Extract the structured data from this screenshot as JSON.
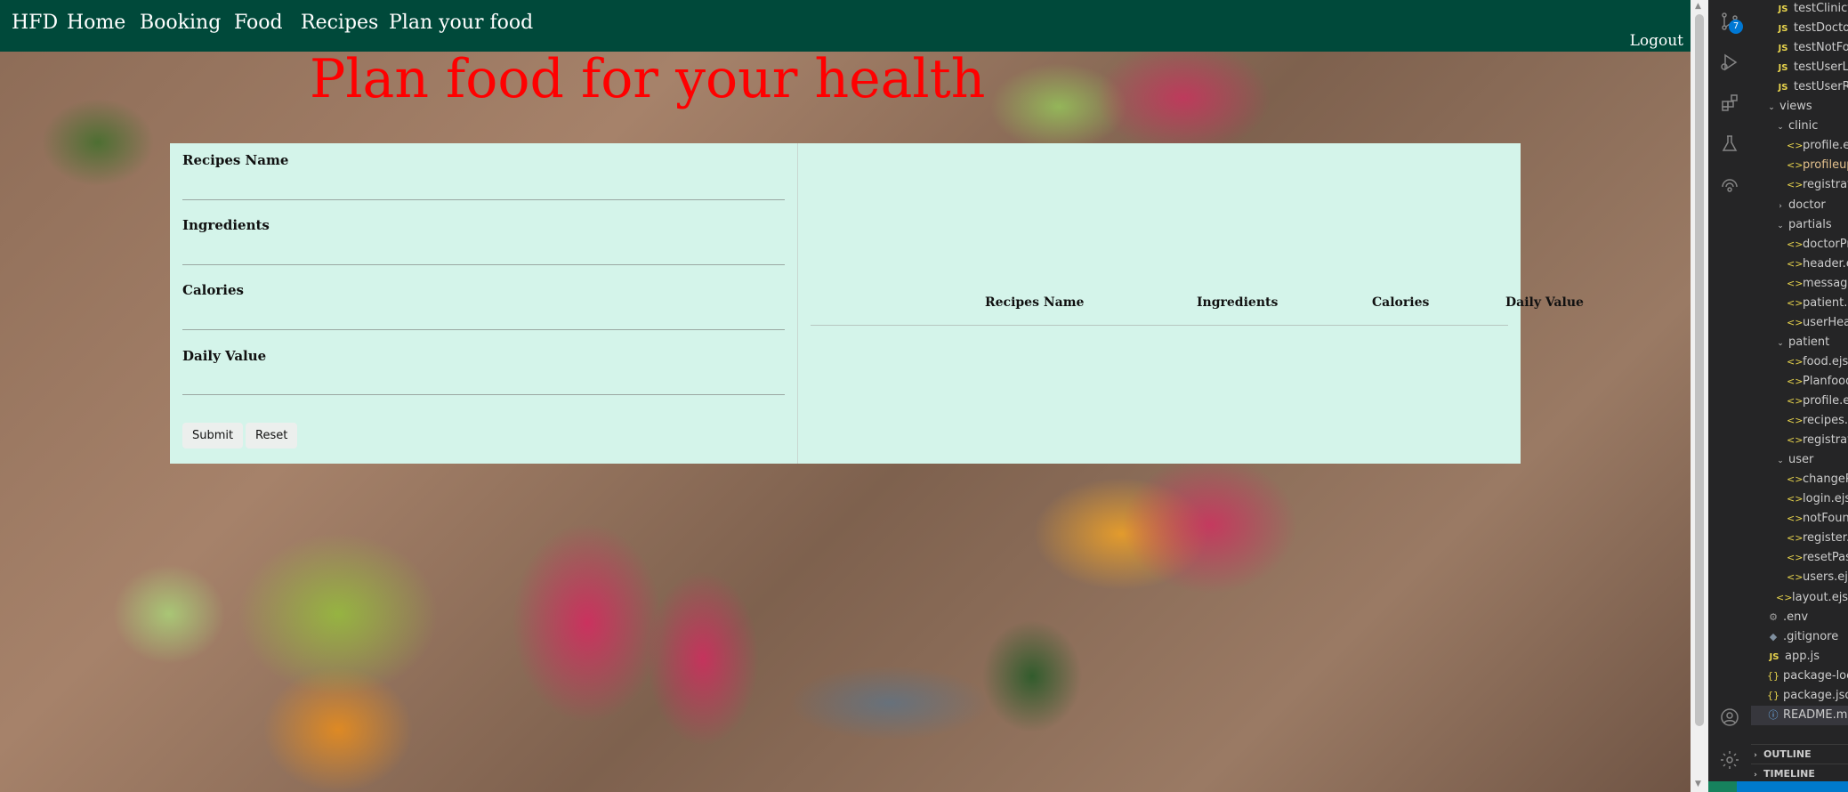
{
  "nav": {
    "brand": "HFD",
    "links": [
      "Home",
      "Booking",
      "Food",
      "Recipes",
      "Plan your food"
    ],
    "logout": "Logout"
  },
  "heading": "Plan food for your health",
  "form": {
    "fields": [
      {
        "label": "Recipes Name",
        "value": ""
      },
      {
        "label": "Ingredients",
        "value": ""
      },
      {
        "label": "Calories",
        "value": ""
      },
      {
        "label": "Daily Value",
        "value": ""
      }
    ],
    "submit_label": "Submit",
    "reset_label": "Reset"
  },
  "table": {
    "columns": [
      "Recipes Name",
      "Ingredients",
      "Calories",
      "Daily Value"
    ],
    "rows": []
  },
  "colors": {
    "navbar": "#00493a",
    "heading": "#ff0000",
    "panel": "#d4f4ea"
  },
  "vscode": {
    "scm_badge": "7",
    "activity_icons": [
      "source-control-icon",
      "run-debug-icon",
      "extensions-icon",
      "testing-icon",
      "remote-explorer-icon",
      "account-icon",
      "settings-gear-icon"
    ],
    "explorer": [
      {
        "name": "testClinicte",
        "type": "js"
      },
      {
        "name": "testDoctor.j",
        "type": "js"
      },
      {
        "name": "testNotFoun",
        "type": "js"
      },
      {
        "name": "testUserLog",
        "type": "js"
      },
      {
        "name": "testUserReg",
        "type": "js"
      },
      {
        "name": "views",
        "type": "folder-open"
      },
      {
        "name": "clinic",
        "type": "folder-open"
      },
      {
        "name": "profile.ejs",
        "type": "ejs"
      },
      {
        "name": "profileupd",
        "type": "ejs",
        "modified": true
      },
      {
        "name": "registration",
        "type": "ejs"
      },
      {
        "name": "doctor",
        "type": "folder-closed"
      },
      {
        "name": "partials",
        "type": "folder-open"
      },
      {
        "name": "doctorProf",
        "type": "ejs"
      },
      {
        "name": "header.ejs",
        "type": "ejs"
      },
      {
        "name": "messages.",
        "type": "ejs"
      },
      {
        "name": "patient.ejs",
        "type": "ejs"
      },
      {
        "name": "userHeade",
        "type": "ejs"
      },
      {
        "name": "patient",
        "type": "folder-open"
      },
      {
        "name": "food.ejs",
        "type": "ejs"
      },
      {
        "name": "Planfood.e",
        "type": "ejs"
      },
      {
        "name": "profile.ejs",
        "type": "ejs"
      },
      {
        "name": "recipes.ejs",
        "type": "ejs"
      },
      {
        "name": "registration",
        "type": "ejs"
      },
      {
        "name": "user",
        "type": "folder-open"
      },
      {
        "name": "changePas",
        "type": "ejs"
      },
      {
        "name": "login.ejs",
        "type": "ejs"
      },
      {
        "name": "notFound.",
        "type": "ejs"
      },
      {
        "name": "register.ejs",
        "type": "ejs"
      },
      {
        "name": "resetPassw",
        "type": "ejs"
      },
      {
        "name": "users.ejs",
        "type": "ejs"
      },
      {
        "name": "layout.ejs",
        "type": "ejs"
      },
      {
        "name": ".env",
        "type": "env"
      },
      {
        "name": ".gitignore",
        "type": "git"
      },
      {
        "name": "app.js",
        "type": "js"
      },
      {
        "name": "package-lock",
        "type": "json"
      },
      {
        "name": "package.json",
        "type": "json"
      },
      {
        "name": "README.md",
        "type": "info",
        "selected": true
      }
    ],
    "sections": [
      "OUTLINE",
      "TIMELINE"
    ]
  }
}
